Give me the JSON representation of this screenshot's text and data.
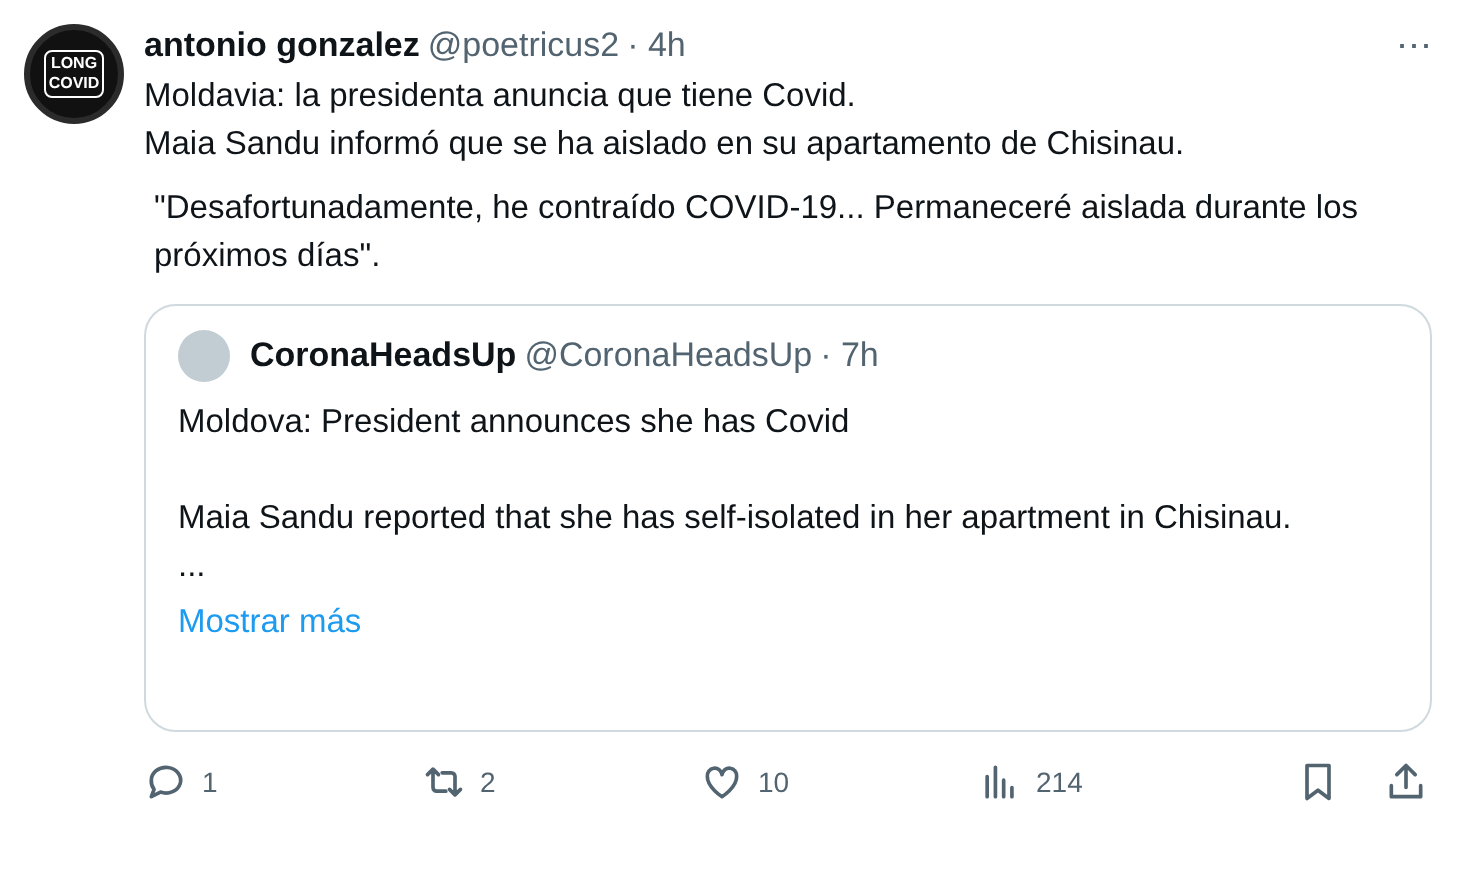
{
  "author": {
    "name": "antonio gonzalez",
    "handle": "@poetricus2",
    "time": "· 4h",
    "avatar_text": "LONG COVID"
  },
  "more": "⋯",
  "body": [
    "Moldavia: la presidenta anuncia que tiene Covid.\nMaia Sandu informó que se ha aislado en su apartamento de Chisinau.",
    "\"Desafortunadamente, he contraído COVID-19... Permaneceré aislada durante los próximos días\"."
  ],
  "quote": {
    "name": "CoronaHeadsUp",
    "handle": "@CoronaHeadsUp",
    "time": "· 7h",
    "paragraphs": [
      "Moldova: President announces she has Covid",
      "Maia Sandu reported that she has self-isolated in her apartment in Chisinau.\n..."
    ],
    "show_more": "Mostrar más"
  },
  "actions": [
    {
      "kind": "reply",
      "count": "1"
    },
    {
      "kind": "repost",
      "count": "2"
    },
    {
      "kind": "like",
      "count": "10"
    },
    {
      "kind": "views",
      "count": "214"
    },
    {
      "kind": "bookmark"
    },
    {
      "kind": "share"
    }
  ]
}
